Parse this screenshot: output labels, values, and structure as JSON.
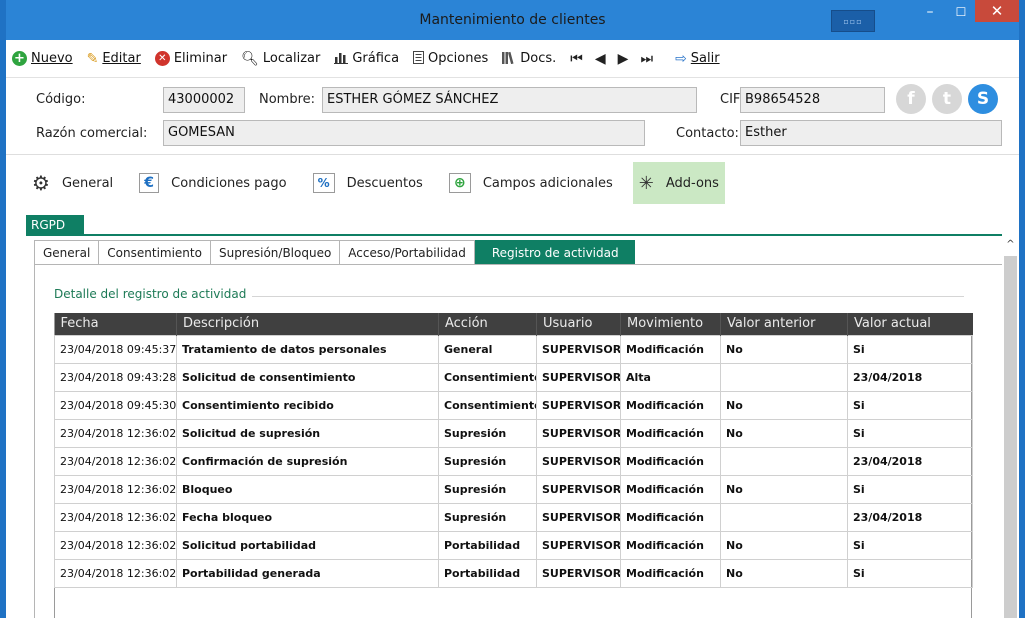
{
  "window": {
    "title": "Mantenimiento de clientes",
    "mini_label": "▫▫▫",
    "minimize": "–",
    "maximize": "☐",
    "close": "✕"
  },
  "toolbar": {
    "nuevo": "Nuevo",
    "editar": "Editar",
    "eliminar": "Eliminar",
    "localizar": "Localizar",
    "grafica": "Gráfica",
    "opciones": "Opciones",
    "docs": "Docs.",
    "salir": "Salir"
  },
  "header": {
    "codigo_label": "Código:",
    "codigo_value": "43000002",
    "nombre_label": "Nombre:",
    "nombre_value": "ESTHER GÓMEZ SÁNCHEZ",
    "cif_label": "CIF:",
    "cif_value": "B98654528",
    "razon_label": "Razón comercial:",
    "razon_value": "GOMESAN",
    "contacto_label": "Contacto:",
    "contacto_value": "Esther"
  },
  "sections": [
    {
      "label": "General",
      "icon": "gears-icon"
    },
    {
      "label": "Condiciones pago",
      "icon": "euro-icon"
    },
    {
      "label": "Descuentos",
      "icon": "percent-icon"
    },
    {
      "label": "Campos adicionales",
      "icon": "add-fields-icon"
    },
    {
      "label": "Add-ons",
      "icon": "addons-icon"
    }
  ],
  "rgpd_tab": "RGPD",
  "subtabs": [
    "General",
    "Consentimiento",
    "Supresión/Bloqueo",
    "Acceso/Portabilidad",
    "Registro de actividad"
  ],
  "group_title": "Detalle del registro de actividad",
  "table": {
    "headers": [
      "Fecha",
      "Descripción",
      "Acción",
      "Usuario",
      "Movimiento",
      "Valor anterior",
      "Valor actual"
    ],
    "rows": [
      [
        "23/04/2018 09:45:37",
        "Tratamiento de datos personales",
        "General",
        "SUPERVISOR",
        "Modificación",
        "No",
        "Si"
      ],
      [
        "23/04/2018 09:43:28",
        "Solicitud de consentimiento",
        "Consentimiento",
        "SUPERVISOR",
        "Alta",
        "",
        "23/04/2018"
      ],
      [
        "23/04/2018 09:45:30",
        "Consentimiento recibido",
        "Consentimiento",
        "SUPERVISOR",
        "Modificación",
        "No",
        "Si"
      ],
      [
        "23/04/2018 12:36:02",
        "Solicitud de supresión",
        "Supresión",
        "SUPERVISOR",
        "Modificación",
        "No",
        "Si"
      ],
      [
        "23/04/2018 12:36:02",
        "Confirmación de supresión",
        "Supresión",
        "SUPERVISOR",
        "Modificación",
        "",
        "23/04/2018"
      ],
      [
        "23/04/2018 12:36:02",
        "Bloqueo",
        "Supresión",
        "SUPERVISOR",
        "Modificación",
        "No",
        "Si"
      ],
      [
        "23/04/2018 12:36:02",
        "Fecha bloqueo",
        "Supresión",
        "SUPERVISOR",
        "Modificación",
        "",
        "23/04/2018"
      ],
      [
        "23/04/2018 12:36:02",
        "Solicitud portabilidad",
        "Portabilidad",
        "SUPERVISOR",
        "Modificación",
        "No",
        "Si"
      ],
      [
        "23/04/2018 12:36:02",
        "Portabilidad generada",
        "Portabilidad",
        "SUPERVISOR",
        "Modificación",
        "No",
        "Si"
      ]
    ]
  },
  "colors": {
    "titlebar": "#2b84d6",
    "accent_green": "#0f7f64",
    "active_section": "#cbe8c4",
    "header_grid": "#404040"
  }
}
